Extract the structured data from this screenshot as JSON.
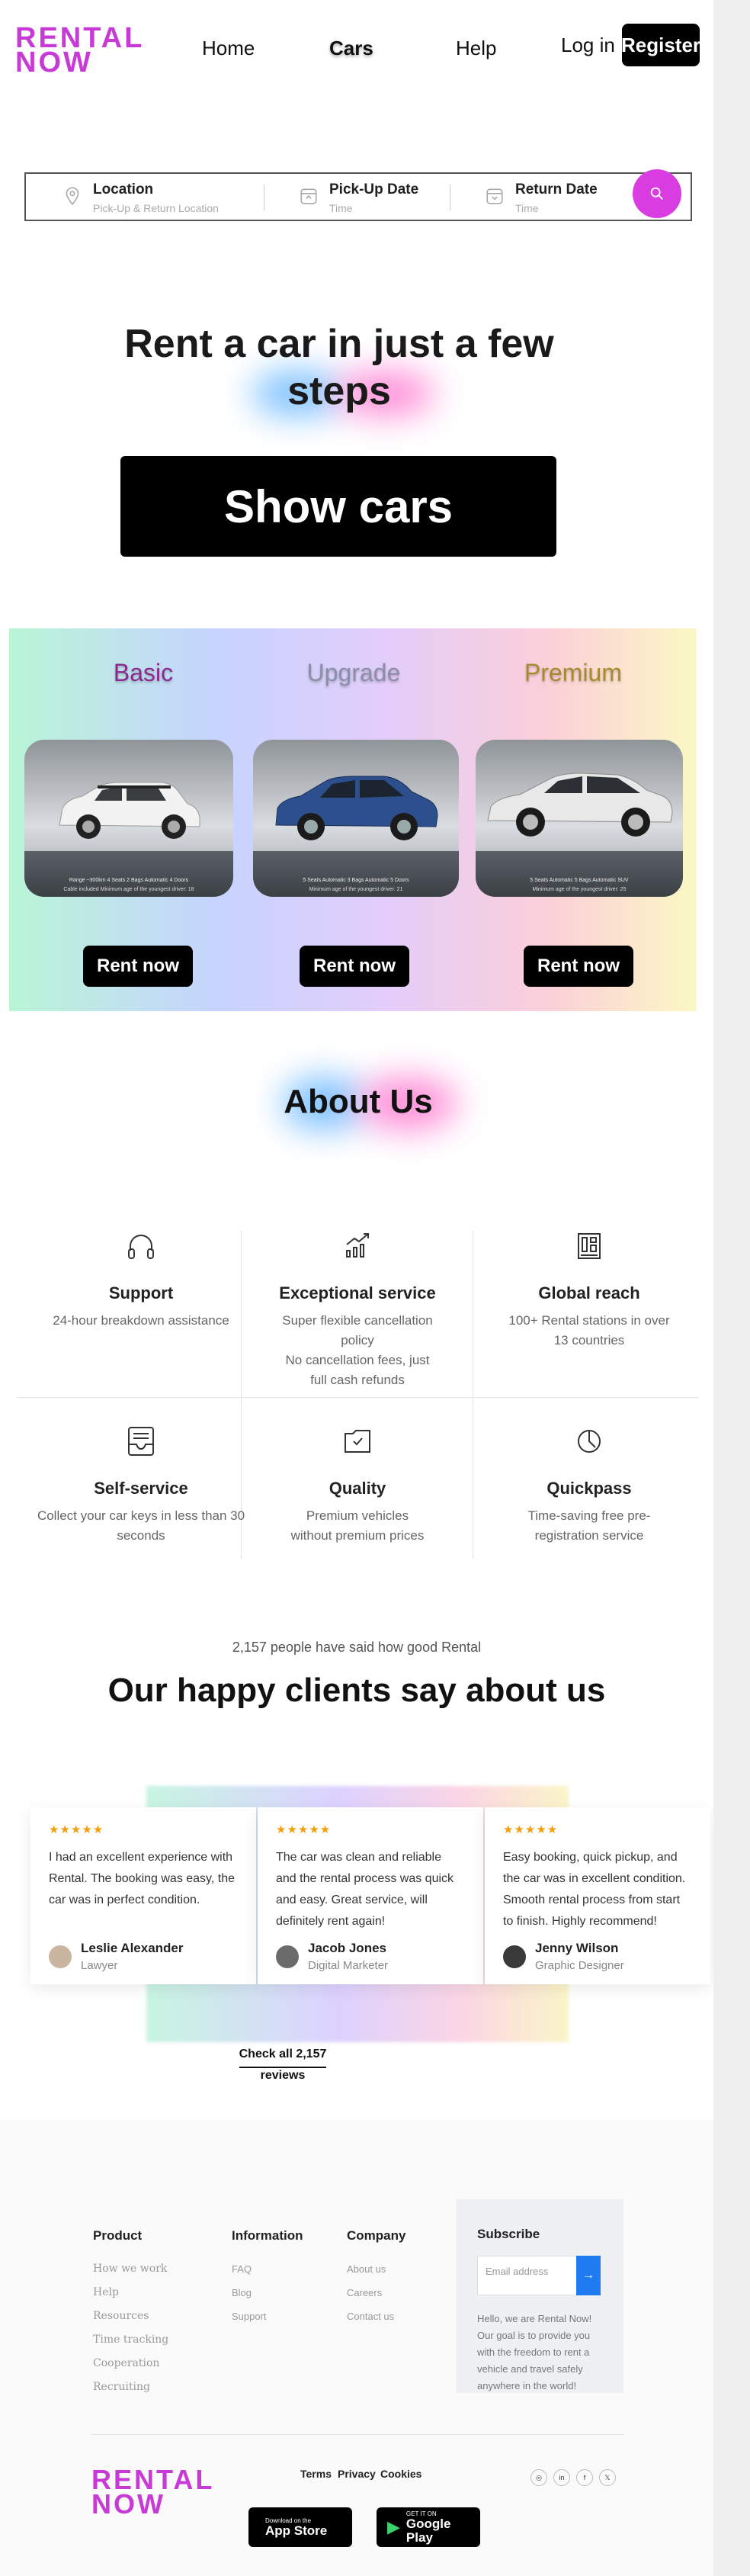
{
  "header": {
    "logo_line1": "RENTAL",
    "logo_line2": "NOW",
    "nav": [
      "Home",
      "Cars",
      "Help"
    ],
    "active_nav": "Cars",
    "login": "Log in",
    "register": "Register"
  },
  "search": {
    "fields": [
      {
        "label": "Location",
        "sub": "Pick-Up & Return Location",
        "icon": "location-pin-icon"
      },
      {
        "label": "Pick-Up Date",
        "sub": "Time",
        "icon": "calendar-icon"
      },
      {
        "label": "Return Date",
        "sub": "Time",
        "icon": "calendar-icon"
      }
    ],
    "button_icon": "search-icon"
  },
  "hero": {
    "title_line1": "Rent a car  in just a few",
    "title_line2": "steps",
    "cta": "Show cars"
  },
  "plans": [
    {
      "name": "Basic",
      "color": "#8a2a8c",
      "car_color": "#f2f2f2",
      "cta": "Rent now",
      "specs": "Range ~300km  4 Seats  2 Bags  Automatic  4 Doors",
      "note": "Cable included  Minimum age of the youngest driver: 18"
    },
    {
      "name": "Upgrade",
      "color": "#8a8fa8",
      "car_color": "#2d4f8e",
      "cta": "Rent now",
      "specs": "5 Seats  Automatic  3 Bags  Automatic  5 Doors",
      "note": "Minimum age of the youngest driver: 21"
    },
    {
      "name": "Premium",
      "color": "#a88a2c",
      "car_color": "#e6e6e6",
      "cta": "Rent now",
      "specs": "5 Seats  Automatic  5 Bags  Automatic  SUV",
      "note": "Minimum age of the youngest driver: 25"
    }
  ],
  "about": {
    "title": "About Us",
    "features": [
      {
        "icon": "headphones-icon",
        "title": "Support",
        "desc": "24-hour breakdown assistance"
      },
      {
        "icon": "chart-up-icon",
        "title": "Exceptional service",
        "desc": "Super flexible cancellation policy\nNo cancellation fees, just full cash refunds"
      },
      {
        "icon": "building-icon",
        "title": "Global reach",
        "desc": "100+ Rental stations in over 13 countries"
      },
      {
        "icon": "document-icon",
        "title": "Self-service",
        "desc": "Collect your car keys in less than 30 seconds"
      },
      {
        "icon": "badge-icon",
        "title": "Quality",
        "desc": "Premium vehicles without premium prices"
      },
      {
        "icon": "clock-icon",
        "title": "Quickpass",
        "desc": "Time-saving free pre-registration service"
      }
    ]
  },
  "testimonials": {
    "pre": "2,157 people have said how good Rental",
    "title": "Our happy clients say about us",
    "stars": "★★★★★",
    "items": [
      {
        "text": "I had an excellent experience with Rental. The booking was easy, the car was in perfect condition.",
        "name": "Leslie Alexander",
        "role": "Lawyer"
      },
      {
        "text": "The car was clean and reliable and the rental process was quick and easy. Great service, will definitely rent again!",
        "name": "Jacob Jones",
        "role": "Digital Marketer"
      },
      {
        "text": "Easy booking, quick pickup, and the car was in excellent condition. Smooth rental process from start to finish. Highly recommend!",
        "name": "Jenny Wilson",
        "role": "Graphic Designer"
      }
    ],
    "check_all_line1": "Check all 2,157",
    "check_all_line2": "reviews"
  },
  "footer": {
    "columns": [
      {
        "title": "Product",
        "links": [
          "How we work",
          "Help",
          "Resources",
          "Time tracking",
          "Cooperation",
          "Recruiting"
        ]
      },
      {
        "title": "Information",
        "links": [
          "FAQ",
          "Blog",
          "Support"
        ]
      },
      {
        "title": "Company",
        "links": [
          "About us",
          "Careers",
          "Contact us"
        ]
      }
    ],
    "subscribe": {
      "title": "Subscribe",
      "placeholder": "Email address",
      "text": "Hello, we are Rental Now! Our goal is to provide you with the freedom to rent a vehicle and travel safely anywhere in the world!"
    },
    "logo_line1": "RENTAL",
    "logo_line2": "NOW",
    "legal": [
      "Terms",
      "Privacy",
      "Cookies"
    ],
    "app_store": {
      "line1": "Download on the",
      "line2": "App Store"
    },
    "google_play": {
      "line1": "GET IT ON",
      "line2": "Google Play"
    },
    "social": [
      "instagram-icon",
      "linkedin-icon",
      "facebook-icon",
      "twitter-icon"
    ],
    "social_glyphs": [
      "◎",
      "in",
      "f",
      "𝕏"
    ]
  }
}
